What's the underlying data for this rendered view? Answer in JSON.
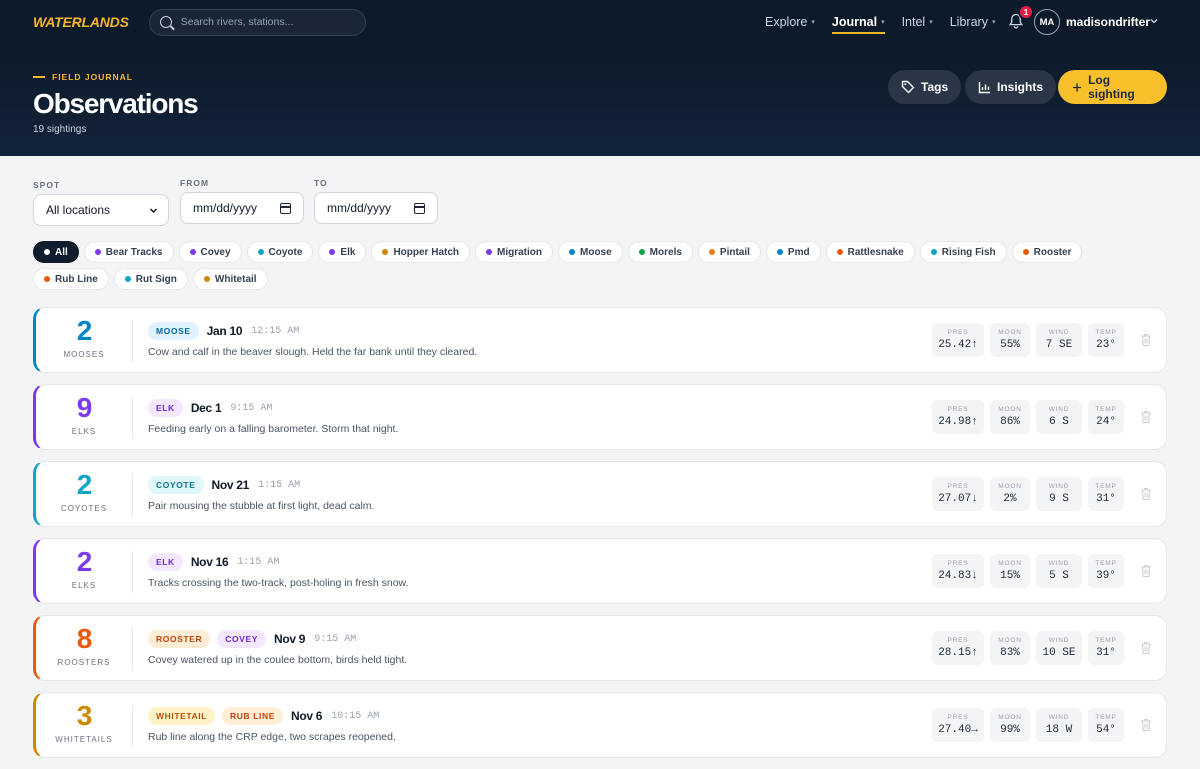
{
  "nav": {
    "logo": "WATERLANDS",
    "search_placeholder": "Search rivers, stations...",
    "links": [
      {
        "label": "Explore",
        "active": false
      },
      {
        "label": "Journal",
        "active": true
      },
      {
        "label": "Intel",
        "active": false
      },
      {
        "label": "Library",
        "active": false
      }
    ],
    "notification_count": "1",
    "avatar_initials": "MA",
    "username": "madisondrifter"
  },
  "header": {
    "eyebrow": "FIELD JOURNAL",
    "title": "Observations",
    "subtitle": "19 sightings",
    "buttons": {
      "tags": "Tags",
      "insights": "Insights",
      "log": "Log sighting"
    }
  },
  "filters": {
    "spot_label": "SPOT",
    "spot_value": "All locations",
    "from_label": "FROM",
    "from_value": "mm/dd/yyyy",
    "to_label": "TO",
    "to_value": "mm/dd/yyyy"
  },
  "chips": [
    {
      "label": "All",
      "active": true,
      "color": "#0f1c2e"
    },
    {
      "label": "Bear Tracks",
      "color": "#7c3aed"
    },
    {
      "label": "Covey",
      "color": "#7c3aed"
    },
    {
      "label": "Coyote",
      "color": "#0ea5c6"
    },
    {
      "label": "Elk",
      "color": "#7c3aed"
    },
    {
      "label": "Hopper Hatch",
      "color": "#ca8a04"
    },
    {
      "label": "Migration",
      "color": "#7c3aed"
    },
    {
      "label": "Moose",
      "color": "#0284c7"
    },
    {
      "label": "Morels",
      "color": "#16a34a"
    },
    {
      "label": "Pintail",
      "color": "#ea7c1a"
    },
    {
      "label": "Pmd",
      "color": "#0284c7"
    },
    {
      "label": "Rattlesnake",
      "color": "#ea580c"
    },
    {
      "label": "Rising Fish",
      "color": "#0ea5c6"
    },
    {
      "label": "Rooster",
      "color": "#ea580c"
    },
    {
      "label": "Rub Line",
      "color": "#ea580c"
    },
    {
      "label": "Rut Sign",
      "color": "#0ea5c6"
    },
    {
      "label": "Whitetail",
      "color": "#ca8a04"
    }
  ],
  "observations": [
    {
      "count": "2",
      "unit": "MOOSES",
      "accent": "#0284c7",
      "tags": [
        {
          "label": "MOOSE",
          "bg": "#e0f2fe",
          "fg": "#0369a1"
        }
      ],
      "date": "Jan 10",
      "time": "12:15 AM",
      "note": "Cow and calf in the beaver slough. Held the far bank until they cleared.",
      "pres": "25.42↑",
      "moon": "55%",
      "wind": "7 SE",
      "temp": "23°"
    },
    {
      "count": "9",
      "unit": "ELKS",
      "accent": "#7c3aed",
      "tags": [
        {
          "label": "ELK",
          "bg": "#f3e8ff",
          "fg": "#6d28d9"
        }
      ],
      "date": "Dec 1",
      "time": "9:15 AM",
      "note": "Feeding early on a falling barometer. Storm that night.",
      "pres": "24.98↑",
      "moon": "86%",
      "wind": "6 S",
      "temp": "24°"
    },
    {
      "count": "2",
      "unit": "COYOTES",
      "accent": "#0ea5c6",
      "tags": [
        {
          "label": "COYOTE",
          "bg": "#e0f7fa",
          "fg": "#0e7490"
        }
      ],
      "date": "Nov 21",
      "time": "1:15 AM",
      "note": "Pair mousing the stubble at first light, dead calm.",
      "pres": "27.07↓",
      "moon": "2%",
      "wind": "9 S",
      "temp": "31°"
    },
    {
      "count": "2",
      "unit": "ELKS",
      "accent": "#7c3aed",
      "tags": [
        {
          "label": "ELK",
          "bg": "#f3e8ff",
          "fg": "#6d28d9"
        }
      ],
      "date": "Nov 16",
      "time": "1:15 AM",
      "note": "Tracks crossing the two-track, post-holing in fresh snow.",
      "pres": "24.83↓",
      "moon": "15%",
      "wind": "5 S",
      "temp": "39°"
    },
    {
      "count": "8",
      "unit": "ROOSTERS",
      "accent": "#ea580c",
      "tags": [
        {
          "label": "ROOSTER",
          "bg": "#ffedd5",
          "fg": "#c2410c"
        },
        {
          "label": "COVEY",
          "bg": "#f3e8ff",
          "fg": "#6d28d9"
        }
      ],
      "date": "Nov 9",
      "time": "9:15 AM",
      "note": "Covey watered up in the coulee bottom, birds held tight.",
      "pres": "28.15↑",
      "moon": "83%",
      "wind": "10 SE",
      "temp": "31°"
    },
    {
      "count": "3",
      "unit": "WHITETAILS",
      "accent": "#ca8a04",
      "tags": [
        {
          "label": "WHITETAIL",
          "bg": "#fef3c7",
          "fg": "#b45309"
        },
        {
          "label": "RUB LINE",
          "bg": "#ffedd5",
          "fg": "#c2410c"
        }
      ],
      "date": "Nov 6",
      "time": "10:15 AM",
      "note": "Rub line along the CRP edge, two scrapes reopened.",
      "pres": "27.40→",
      "moon": "99%",
      "wind": "18 W",
      "temp": "54°"
    }
  ],
  "stat_labels": {
    "pres": "PRES",
    "moon": "MOON",
    "wind": "WIND",
    "temp": "TEMP"
  }
}
